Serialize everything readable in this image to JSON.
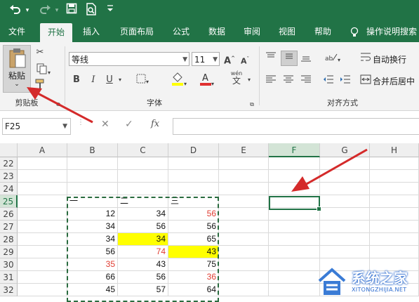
{
  "quick_access": {
    "undo_icon": "undo-icon",
    "redo_icon": "redo-icon",
    "save_icon": "save-icon",
    "preview_icon": "print-preview-icon",
    "more_icon": "customize-icon"
  },
  "tabs": [
    {
      "label": "文件"
    },
    {
      "label": "开始",
      "active": true
    },
    {
      "label": "插入"
    },
    {
      "label": "页面布局"
    },
    {
      "label": "公式"
    },
    {
      "label": "数据"
    },
    {
      "label": "审阅"
    },
    {
      "label": "视图"
    },
    {
      "label": "帮助"
    },
    {
      "label": "操作说明搜索"
    }
  ],
  "ribbon": {
    "clipboard": {
      "paste_label": "粘贴",
      "group_label": "剪贴板"
    },
    "font": {
      "font_name": "等线",
      "font_size": "11",
      "group_label": "字体",
      "bold": "B",
      "italic": "I",
      "underline": "U",
      "grow": "A",
      "shrink": "A",
      "wen": "wén"
    },
    "alignment": {
      "wrap_label": "自动换行",
      "merge_label": "合并后居中",
      "group_label": "对齐方式"
    }
  },
  "formula_bar": {
    "name_box": "F25",
    "fx": "fx",
    "formula": ""
  },
  "grid": {
    "columns": [
      "A",
      "B",
      "C",
      "D",
      "E",
      "F",
      "G",
      "H"
    ],
    "selected_column": "F",
    "rows": [
      "22",
      "23",
      "24",
      "25",
      "26",
      "27",
      "28",
      "29",
      "30",
      "31",
      "32"
    ],
    "selected_row": "25",
    "cells": {
      "25": {
        "B": "一",
        "C": "二",
        "D": "三"
      },
      "26": {
        "B": "12",
        "C": "34",
        "D": "56"
      },
      "27": {
        "B": "34",
        "C": "56",
        "D": "56"
      },
      "28": {
        "B": "34",
        "C": "34",
        "D": "65"
      },
      "29": {
        "B": "56",
        "C": "74",
        "D": "43"
      },
      "30": {
        "B": "35",
        "C": "43",
        "D": "75"
      },
      "31": {
        "B": "66",
        "C": "56",
        "D": "36"
      },
      "32": {
        "B": "45",
        "C": "57",
        "D": "64"
      }
    },
    "active_cell": "F25"
  },
  "colors": {
    "excel_green": "#217346",
    "highlight_yellow": "#ffff00",
    "red_text": "#e03c31",
    "arrow_red": "#d42a2a"
  },
  "watermark": {
    "title": "系统之家",
    "subtitle": "XITONGZHIJIA.NET"
  }
}
